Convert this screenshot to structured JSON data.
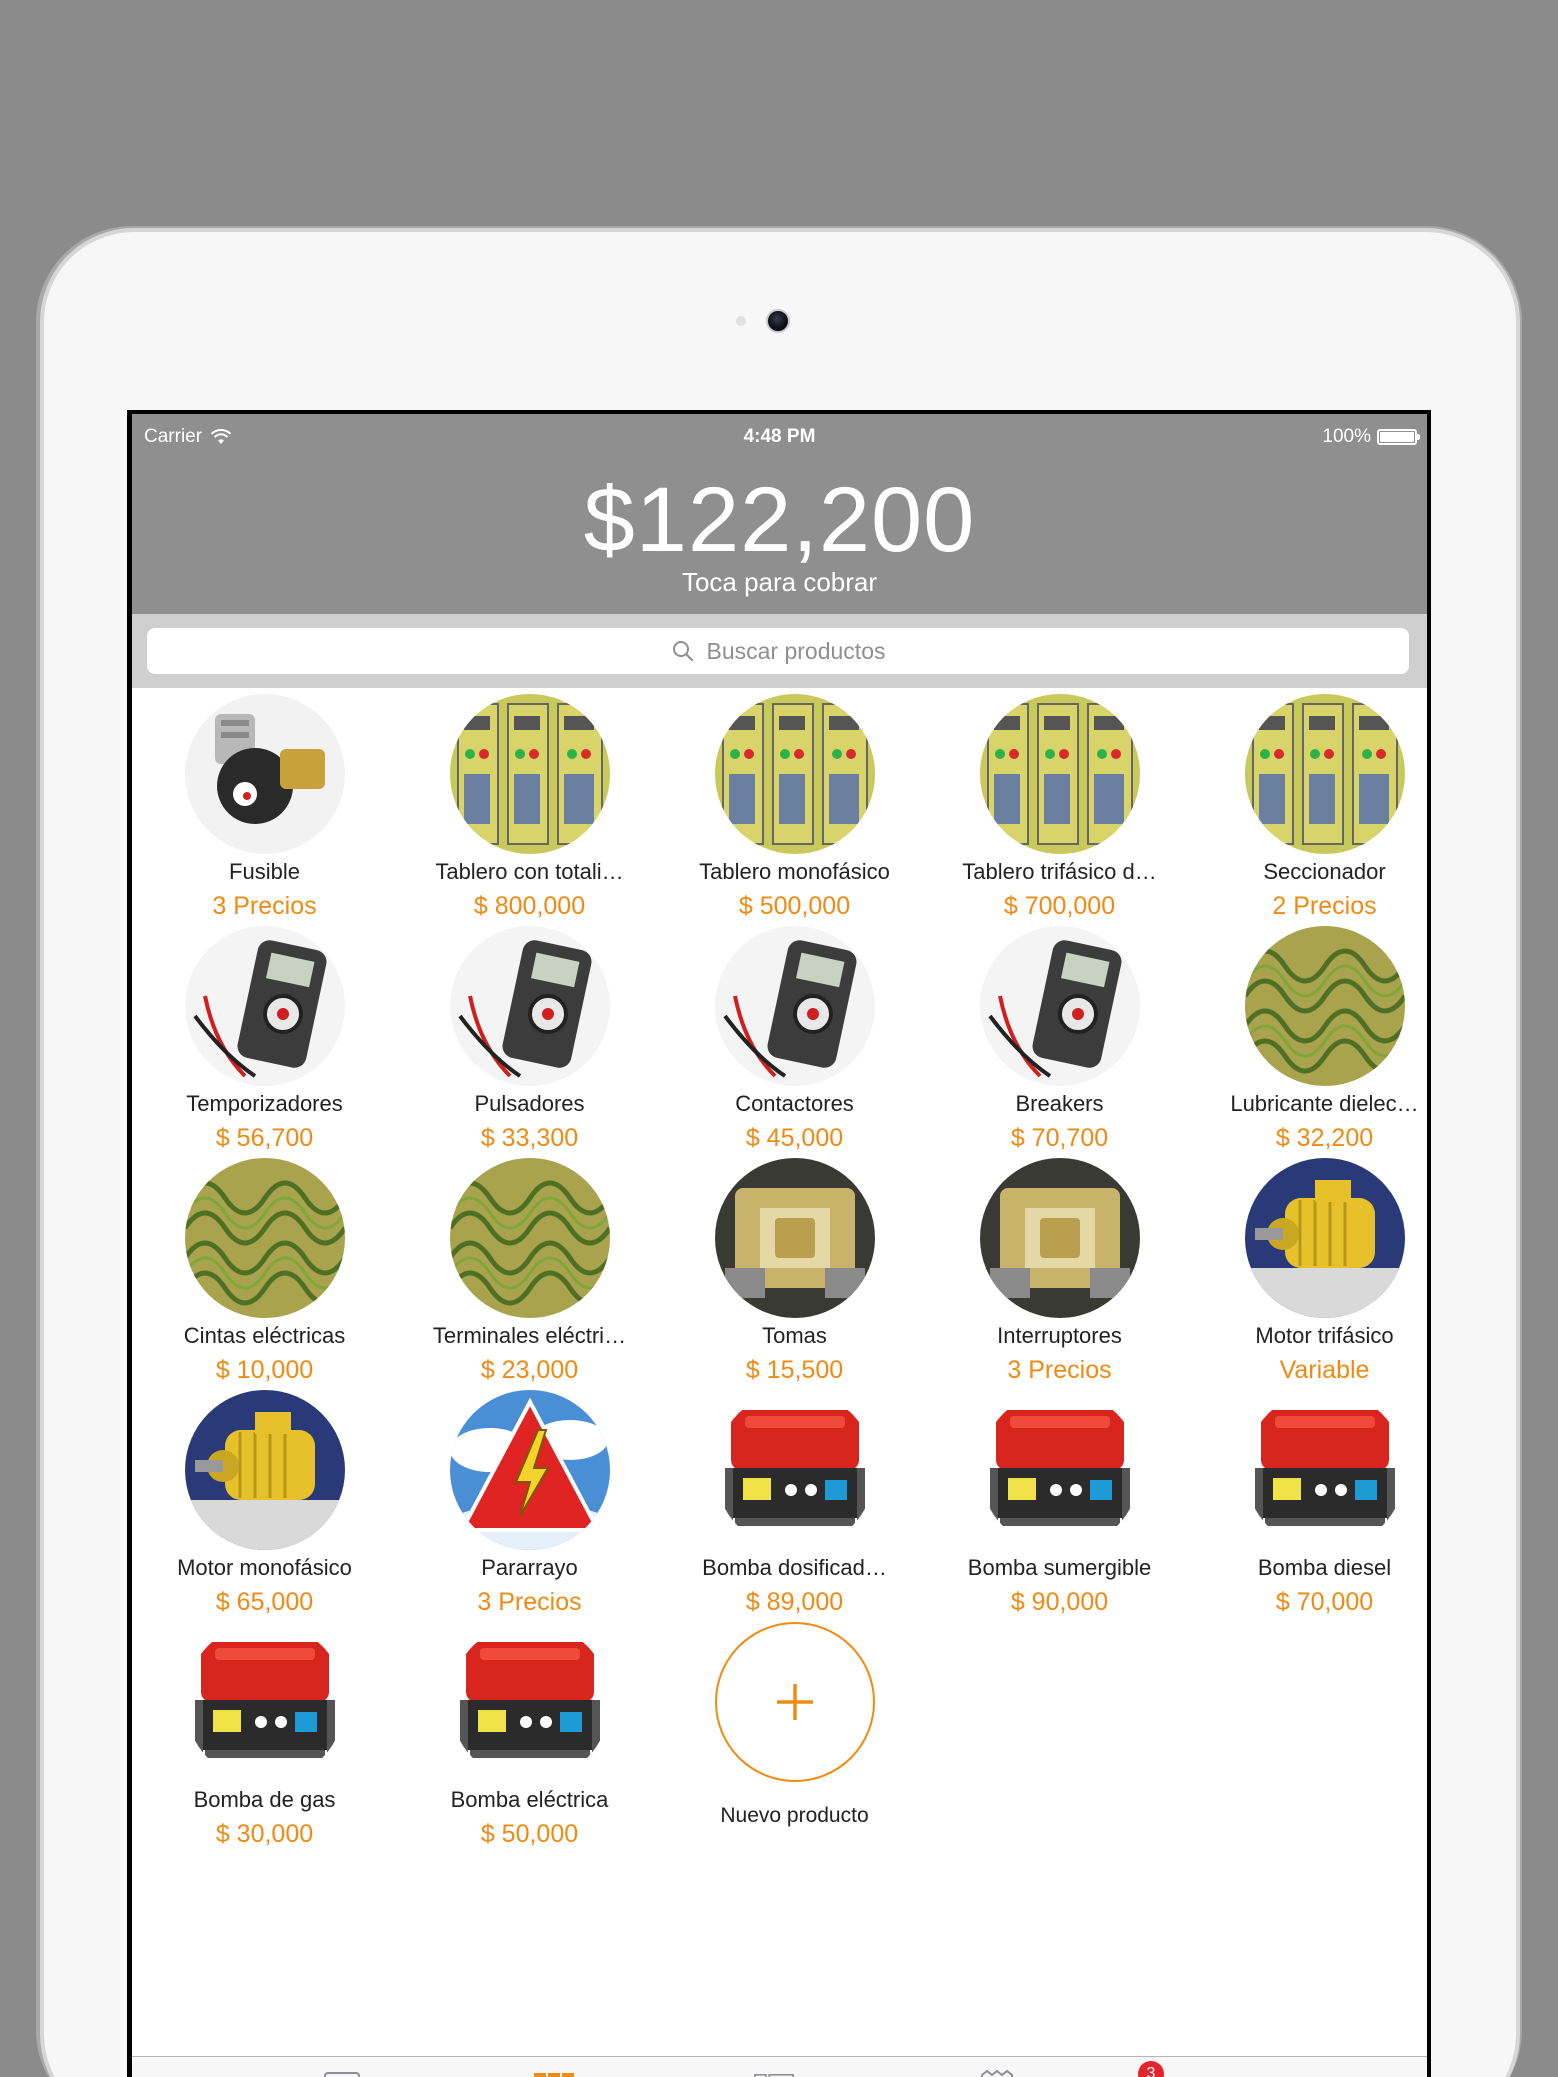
{
  "status_bar": {
    "carrier": "Carrier",
    "time": "4:48 PM",
    "battery": "100%"
  },
  "header": {
    "total": "$122,200",
    "hint": "Toca para cobrar"
  },
  "search": {
    "placeholder": "Buscar productos"
  },
  "colors": {
    "accent": "#f08a12",
    "header_bg": "#8f8f8f",
    "badge": "#e3242b"
  },
  "products": [
    {
      "name": "Fusible",
      "price": "3 Precios",
      "image": "fuse-photo"
    },
    {
      "name": "Tablero con totali…",
      "price": "$ 800,000",
      "image": "panel-photo"
    },
    {
      "name": "Tablero monofásico",
      "price": "$ 500,000",
      "image": "panel-photo"
    },
    {
      "name": "Tablero trifásico d…",
      "price": "$ 700,000",
      "image": "panel-photo"
    },
    {
      "name": "Seccionador",
      "price": "2 Precios",
      "image": "panel-photo"
    },
    {
      "name": "Temporizadores",
      "price": "$ 56,700",
      "image": "multimeter-photo"
    },
    {
      "name": "Pulsadores",
      "price": "$ 33,300",
      "image": "multimeter-photo"
    },
    {
      "name": "Contactores",
      "price": "$ 45,000",
      "image": "multimeter-photo"
    },
    {
      "name": "Breakers",
      "price": "$ 70,700",
      "image": "multimeter-photo"
    },
    {
      "name": "Lubricante dielec…",
      "price": "$ 32,200",
      "image": "coil-photo"
    },
    {
      "name": "Cintas eléctricas",
      "price": "$ 10,000",
      "image": "coil-photo"
    },
    {
      "name": "Terminales eléctri…",
      "price": "$ 23,000",
      "image": "coil-photo"
    },
    {
      "name": "Tomas",
      "price": "$ 15,500",
      "image": "mechanism-photo"
    },
    {
      "name": "Interruptores",
      "price": "3 Precios",
      "image": "mechanism-photo"
    },
    {
      "name": "Motor trifásico",
      "price": "Variable",
      "image": "motor-photo"
    },
    {
      "name": "Motor monofásico",
      "price": "$ 65,000",
      "image": "motor-photo"
    },
    {
      "name": "Pararrayo",
      "price": "3 Precios",
      "image": "lightning-photo"
    },
    {
      "name": "Bomba dosificad…",
      "price": "$ 89,000",
      "image": "generator-photo"
    },
    {
      "name": "Bomba sumergible",
      "price": "$ 90,000",
      "image": "generator-photo"
    },
    {
      "name": "Bomba diesel",
      "price": "$ 70,000",
      "image": "generator-photo"
    },
    {
      "name": "Bomba de gas",
      "price": "$ 30,000",
      "image": "generator-photo"
    },
    {
      "name": "Bomba eléctrica",
      "price": "$ 50,000",
      "image": "generator-photo"
    }
  ],
  "new_product": {
    "label": "Nuevo producto",
    "icon": "plus-icon"
  },
  "tabbar": {
    "tabs": [
      {
        "icon": "register-icon"
      },
      {
        "icon": "grid-icon",
        "active": true
      },
      {
        "icon": "layout-icon"
      },
      {
        "icon": "receipts-icon",
        "badge": "3"
      },
      {
        "icon": "more-icon"
      }
    ]
  }
}
